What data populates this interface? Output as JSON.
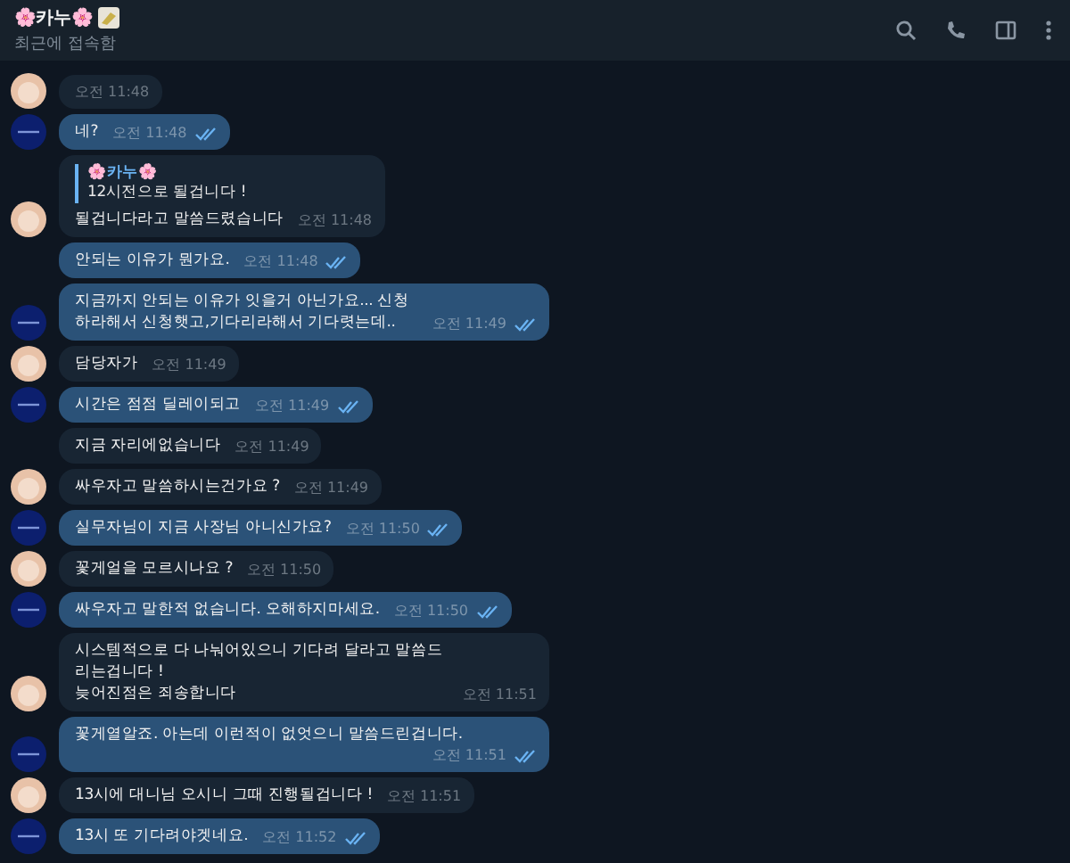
{
  "header": {
    "title": "🌸카누🌸",
    "status": "최근에 접속함"
  },
  "messages": [
    {
      "kind": "in",
      "avatar": true,
      "time": "오전 11:48"
    },
    {
      "kind": "out",
      "avatar": true,
      "text": "네?",
      "time": "오전 11:48",
      "read": true
    },
    {
      "kind": "in",
      "avatar": true,
      "reply": {
        "name": "🌸카누🌸",
        "text": "12시전으로 될겁니다 !"
      },
      "text": "될겁니다라고 말씀드렸습니다",
      "time": "오전 11:48"
    },
    {
      "kind": "out",
      "avatar": false,
      "text": "안되는 이유가 뭔가요.",
      "time": "오전 11:48",
      "read": true
    },
    {
      "kind": "out",
      "avatar": true,
      "text": "지금까지 안되는 이유가 잇을거 아닌가요... 신청하라해서 신청햇고,기다리라해서 기다렷는데..",
      "time": "오전 11:49",
      "read": true
    },
    {
      "kind": "in",
      "avatar": true,
      "text": "담당자가",
      "time": "오전 11:49"
    },
    {
      "kind": "out",
      "avatar": true,
      "text": "시간은 점점 딜레이되고",
      "time": "오전 11:49",
      "read": true
    },
    {
      "kind": "in",
      "avatar": false,
      "text": "지금 자리에없습니다",
      "time": "오전 11:49"
    },
    {
      "kind": "in",
      "avatar": true,
      "text": "싸우자고 말씀하시는건가요 ?",
      "time": "오전 11:49"
    },
    {
      "kind": "out",
      "avatar": true,
      "text": "실무자님이 지금 사장님 아니신가요?",
      "time": "오전 11:50",
      "read": true
    },
    {
      "kind": "in",
      "avatar": true,
      "text": "꽃게얼을 모르시나요 ?",
      "time": "오전 11:50"
    },
    {
      "kind": "out",
      "avatar": true,
      "text": "싸우자고 말한적 없습니다. 오해하지마세요.",
      "time": "오전 11:50",
      "read": true
    },
    {
      "kind": "in",
      "avatar": true,
      "text": "시스템적으로 다 나눠어있으니 기다려 달라고 말씀드리는겁니다 !\n늦어진점은 죄송합니다",
      "time": "오전 11:51"
    },
    {
      "kind": "out",
      "avatar": true,
      "text": "꽃게열알죠. 아는데 이런적이 없엇으니 말씀드린겁니다.",
      "time": "오전 11:51",
      "read": true
    },
    {
      "kind": "in",
      "avatar": true,
      "text": "13시에 대니님 오시니 그때 진행될겁니다 !",
      "time": "오전 11:51"
    },
    {
      "kind": "out",
      "avatar": true,
      "text": "13시 또 기다려야겟네요.",
      "time": "오전 11:52",
      "read": true
    }
  ]
}
